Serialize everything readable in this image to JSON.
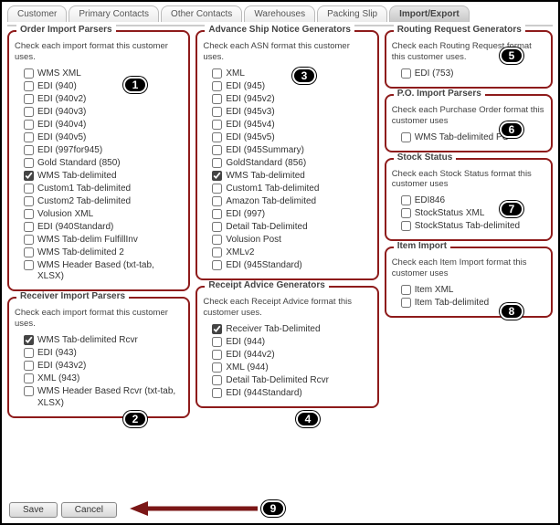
{
  "tabs": {
    "items": [
      "Customer",
      "Primary Contacts",
      "Other Contacts",
      "Warehouses",
      "Packing Slip",
      "Import/Export"
    ],
    "activeIndex": 5
  },
  "panels": {
    "orderImport": {
      "title": "Order Import Parsers",
      "desc": "Check each import format this customer uses.",
      "options": [
        {
          "label": "WMS XML",
          "checked": false
        },
        {
          "label": "EDI (940)",
          "checked": false
        },
        {
          "label": "EDI (940v2)",
          "checked": false
        },
        {
          "label": "EDI (940v3)",
          "checked": false
        },
        {
          "label": "EDI (940v4)",
          "checked": false
        },
        {
          "label": "EDI (940v5)",
          "checked": false
        },
        {
          "label": "EDI (997for945)",
          "checked": false
        },
        {
          "label": "Gold Standard (850)",
          "checked": false
        },
        {
          "label": "WMS Tab-delimited",
          "checked": true
        },
        {
          "label": "Custom1 Tab-delimited",
          "checked": false
        },
        {
          "label": "Custom2 Tab-delimited",
          "checked": false
        },
        {
          "label": "Volusion XML",
          "checked": false
        },
        {
          "label": "EDI (940Standard)",
          "checked": false
        },
        {
          "label": "WMS Tab-delim FulfillInv",
          "checked": false
        },
        {
          "label": "WMS Tab-delimited 2",
          "checked": false
        },
        {
          "label": "WMS Header Based (txt-tab, XLSX)",
          "checked": false
        }
      ]
    },
    "receiverImport": {
      "title": "Receiver Import Parsers",
      "desc": "Check each import format this customer uses.",
      "options": [
        {
          "label": "WMS Tab-delimited Rcvr",
          "checked": true
        },
        {
          "label": "EDI (943)",
          "checked": false
        },
        {
          "label": "EDI (943v2)",
          "checked": false
        },
        {
          "label": "XML (943)",
          "checked": false
        },
        {
          "label": "WMS Header Based Rcvr (txt-tab, XLSX)",
          "checked": false
        }
      ]
    },
    "asn": {
      "title": "Advance Ship Notice Generators",
      "desc": "Check each ASN format this customer uses.",
      "options": [
        {
          "label": "XML",
          "checked": false
        },
        {
          "label": "EDI (945)",
          "checked": false
        },
        {
          "label": "EDI (945v2)",
          "checked": false
        },
        {
          "label": "EDI (945v3)",
          "checked": false
        },
        {
          "label": "EDI (945v4)",
          "checked": false
        },
        {
          "label": "EDI (945v5)",
          "checked": false
        },
        {
          "label": "EDI (945Summary)",
          "checked": false
        },
        {
          "label": "GoldStandard (856)",
          "checked": false
        },
        {
          "label": "WMS Tab-delimited",
          "checked": true
        },
        {
          "label": "Custom1 Tab-delimited",
          "checked": false
        },
        {
          "label": "Amazon Tab-delimited",
          "checked": false
        },
        {
          "label": "EDI (997)",
          "checked": false
        },
        {
          "label": "Detail Tab-Delimited",
          "checked": false
        },
        {
          "label": "Volusion Post",
          "checked": false
        },
        {
          "label": "XMLv2",
          "checked": false
        },
        {
          "label": "EDI (945Standard)",
          "checked": false
        }
      ]
    },
    "receiptAdvice": {
      "title": "Receipt Advice Generators",
      "desc": "Check each Receipt Advice format this customer uses.",
      "options": [
        {
          "label": "Receiver Tab-Delimited",
          "checked": true
        },
        {
          "label": "EDI (944)",
          "checked": false
        },
        {
          "label": "EDI (944v2)",
          "checked": false
        },
        {
          "label": "XML (944)",
          "checked": false
        },
        {
          "label": "Detail Tab-Delimited Rcvr",
          "checked": false
        },
        {
          "label": "EDI (944Standard)",
          "checked": false
        }
      ]
    },
    "routingRequest": {
      "title": "Routing Request Generators",
      "desc": "Check each Routing Request format this customer uses.",
      "options": [
        {
          "label": "EDI (753)",
          "checked": false
        }
      ]
    },
    "poImport": {
      "title": "P.O. Import Parsers",
      "desc": "Check each Purchase Order format this customer uses",
      "options": [
        {
          "label": "WMS Tab-delimited PO",
          "checked": false
        }
      ]
    },
    "stockStatus": {
      "title": "Stock Status",
      "desc": "Check each Stock Status format this customer uses",
      "options": [
        {
          "label": "EDI846",
          "checked": false
        },
        {
          "label": "StockStatus XML",
          "checked": false
        },
        {
          "label": "StockStatus Tab-delimited",
          "checked": false
        }
      ]
    },
    "itemImport": {
      "title": "Item Import",
      "desc": "Check each Item Import format this customer uses",
      "options": [
        {
          "label": "Item XML",
          "checked": false
        },
        {
          "label": "Item Tab-delimited",
          "checked": false
        }
      ]
    }
  },
  "buttons": {
    "save": "Save",
    "cancel": "Cancel"
  },
  "markers": [
    "1",
    "2",
    "3",
    "4",
    "5",
    "6",
    "7",
    "8",
    "9"
  ]
}
